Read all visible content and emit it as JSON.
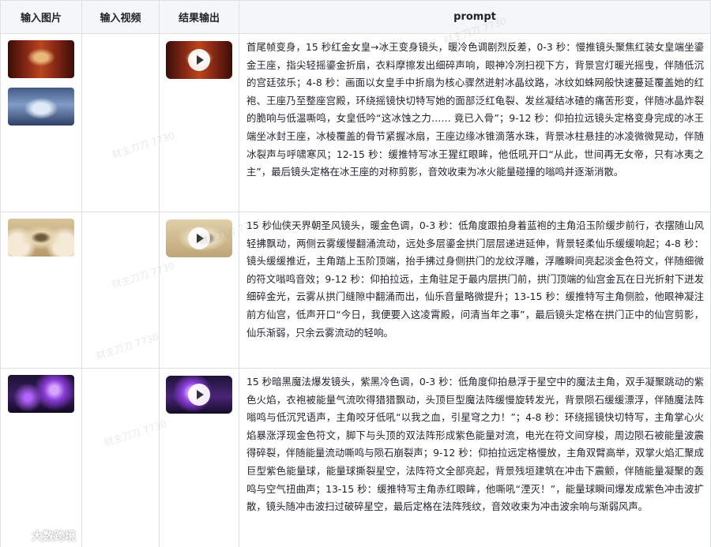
{
  "table": {
    "headers": {
      "input_image": "输入图片",
      "input_video": "输入视频",
      "result_output": "结果输出",
      "prompt": "prompt"
    },
    "rows": [
      {
        "prompt": "首尾帧变身，15 秒红金女皇→冰王变身镜头，暖冷色调剧烈反差，0-3 秒：慢推镜头聚焦红装女皇端坐鎏金王座，指尖轻摇鎏金折扇，衣料摩擦发出细碎声响，眼神冷冽扫视下方，背景宫灯暖光摇曳，伴随低沉的宫廷弦乐；4-8 秒：画面以女皇手中折扇为核心骤然迸射冰晶纹路，冰纹如蛛网般快速蔓延覆盖她的红袍、王座乃至整座宫殿，环绕摇镜快切特写她的面部泛红龟裂、发丝凝结冰碴的痛苦形变，伴随冰晶炸裂的脆响与低温嘶鸣，女皇低吟“这冰蚀之力…… 竟已入骨”；9-12 秒：仰拍拉远镜头定格变身完成的冰王端坐冰封王座，冰棱覆盖的骨节紧握冰扇，王座边缘冰锥滴落水珠，背景冰柱悬挂的冰凌微微晃动，伴随冰裂声与呼啸寒风；12-15 秒：缓推特写冰王猩红眼眸，他低吼开口“从此，世间再无女帝，只有冰夷之主”，最后镜头定格在冰王座的对称剪影，音效收束为冰火能量碰撞的嗡鸣并逐渐消散。"
      },
      {
        "prompt": "15 秒仙侠天界朝圣风镜头，暖金色调，0-3 秒：低角度跟拍身着蓝袍的主角沿玉阶缓步前行，衣摆随山风轻拂飘动，两侧云雾缓慢翻涌流动，远处多层鎏金拱门层层递进延伸，背景轻柔仙乐缓缓响起；4-8 秒：镜头缓缓推近，主角踏上玉阶顶端，抬手拂过身侧拱门的龙纹浮雕，浮雕瞬间亮起淡金色符文，伴随细微的符文嗡鸣音效；9-12 秒：仰拍拉远，主角驻足于最内层拱门前，拱门顶端的仙宫金瓦在日光折射下迸发细碎金光，云雾从拱门缝隙中翻涌而出，仙乐音量略微提升；13-15 秒：缓推特写主角侧脸，他眼神凝注前方仙宫，低声开口“今日，我便要入这凌霄殿，问清当年之事”，最后镜头定格在拱门正中的仙宫剪影，仙乐渐弱，只余云雾流动的轻响。"
      },
      {
        "prompt": "15 秒暗黑魔法爆发镜头，紫黑冷色调，0-3 秒：低角度仰拍悬浮于星空中的魔法主角，双手凝聚跳动的紫色火焰，衣袍被能量气流吹得猎猎飘动，头顶巨型魔法阵缓慢旋转发光，背景陨石缓缓漂浮，伴随魔法阵嗡鸣与低沉咒语声，主角咬牙低吼“以我之血，引星穹之力！”；4-8 秒：环绕摇镜快切特写，主角掌心火焰暴涨浮现金色符文，脚下与头顶的双法阵形成紫色能量对流，电光在符文间穿梭，周边陨石被能量波震得碎裂，伴随能量流动嘶鸣与陨石崩裂声；9-12 秒：仰拍拉远定格慢放，主角双臂高举，双掌火焰汇聚成巨型紫色能量球，能量球撕裂星空，法阵符文全部亮起，背景残垣建筑在冲击下震颤，伴随能量凝聚的轰鸣与空气扭曲声；13-15 秒：缓推特写主角赤红眼眸，他嘶吼“湮灭！”，能量球瞬间爆发成紫色冲击波扩散，镜头随冲击波扫过破碎星空，最后定格在法阵残纹，音效收束为冲击波余响与渐弱风声。"
      }
    ]
  },
  "watermarks": [
    "财主刀刀 7730",
    "财主刀刀 7730",
    "财主刀刀 7730",
    "财主刀刀 7730",
    "财主刀刀 7730",
    "财主刀刀 7730",
    "财主刀刀 7730"
  ],
  "footer": {
    "brand": "大数跨境"
  }
}
